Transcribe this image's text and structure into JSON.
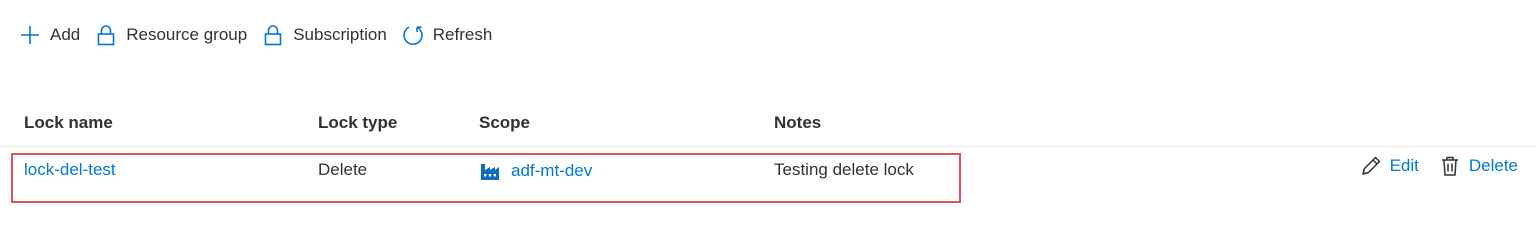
{
  "toolbar": {
    "add_label": "Add",
    "resource_group_label": "Resource group",
    "subscription_label": "Subscription",
    "refresh_label": "Refresh"
  },
  "table": {
    "columns": [
      "Lock name",
      "Lock type",
      "Scope",
      "Notes"
    ],
    "rows": [
      {
        "lock_name": "lock-del-test",
        "lock_type": "Delete",
        "scope": "adf-mt-dev",
        "notes": "Testing delete lock",
        "edit_label": "Edit",
        "delete_label": "Delete"
      }
    ]
  },
  "icons": {
    "add": "plus-icon",
    "resource_group": "lock-icon",
    "subscription": "lock-icon",
    "refresh": "refresh-icon",
    "scope": "data-factory-icon",
    "edit": "pencil-icon",
    "delete": "trash-icon"
  },
  "colors": {
    "accent": "#0078d4",
    "highlight_border": "#e0535a",
    "text": "#323130"
  }
}
